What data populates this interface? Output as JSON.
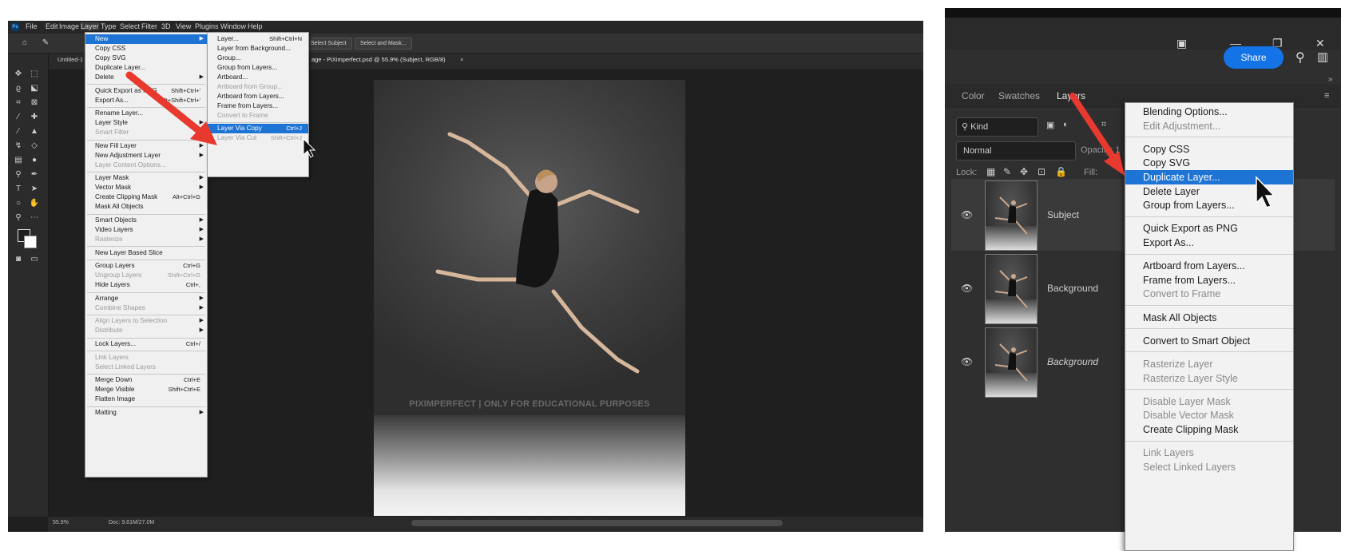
{
  "left": {
    "menubar": [
      "File",
      "Edit",
      "Image",
      "Layer",
      "Type",
      "Select",
      "Filter",
      "3D",
      "View",
      "Plugins",
      "Window",
      "Help"
    ],
    "options": {
      "select_subject": "Select Subject",
      "select_and_mask": "Select and Mask..."
    },
    "doc_tabs": {
      "first": "Untitled-1",
      "active": "age - PiXimperfect.psd @ 55.9% (Subject, RGB/8)"
    },
    "watermark": "PIXIMPERFECT | ONLY FOR EDUCATIONAL PURPOSES",
    "status": {
      "zoom": "55.9%",
      "doc": "Doc: 9.81M/27.0M"
    },
    "layer_menu": [
      {
        "label": "New",
        "hl": true,
        "sub": true
      },
      {
        "label": "Copy CSS"
      },
      {
        "label": "Copy SVG"
      },
      {
        "label": "Duplicate Layer..."
      },
      {
        "label": "Delete",
        "sub": true
      },
      {
        "sep": true
      },
      {
        "label": "Quick Export as PNG",
        "sc": "Shift+Ctrl+'"
      },
      {
        "label": "Export As...",
        "sc": "Alt+Shift+Ctrl+'"
      },
      {
        "sep": true
      },
      {
        "label": "Rename Layer..."
      },
      {
        "label": "Layer Style",
        "sub": true
      },
      {
        "label": "Smart Filter",
        "dis": true,
        "sub": true
      },
      {
        "sep": true
      },
      {
        "label": "New Fill Layer",
        "sub": true
      },
      {
        "label": "New Adjustment Layer",
        "sub": true
      },
      {
        "label": "Layer Content Options...",
        "dis": true
      },
      {
        "sep": true
      },
      {
        "label": "Layer Mask",
        "sub": true
      },
      {
        "label": "Vector Mask",
        "sub": true
      },
      {
        "label": "Create Clipping Mask",
        "sc": "Alt+Ctrl+G"
      },
      {
        "label": "Mask All Objects"
      },
      {
        "sep": true
      },
      {
        "label": "Smart Objects",
        "sub": true
      },
      {
        "label": "Video Layers",
        "sub": true
      },
      {
        "label": "Rasterize",
        "dis": true,
        "sub": true
      },
      {
        "sep": true
      },
      {
        "label": "New Layer Based Slice"
      },
      {
        "sep": true
      },
      {
        "label": "Group Layers",
        "sc": "Ctrl+G"
      },
      {
        "label": "Ungroup Layers",
        "sc": "Shift+Ctrl+G",
        "dis": true
      },
      {
        "label": "Hide Layers",
        "sc": "Ctrl+,"
      },
      {
        "sep": true
      },
      {
        "label": "Arrange",
        "sub": true
      },
      {
        "label": "Combine Shapes",
        "dis": true,
        "sub": true
      },
      {
        "sep": true
      },
      {
        "label": "Align Layers to Selection",
        "dis": true,
        "sub": true
      },
      {
        "label": "Distribute",
        "dis": true,
        "sub": true
      },
      {
        "sep": true
      },
      {
        "label": "Lock Layers...",
        "sc": "Ctrl+/"
      },
      {
        "sep": true
      },
      {
        "label": "Link Layers",
        "dis": true
      },
      {
        "label": "Select Linked Layers",
        "dis": true
      },
      {
        "sep": true
      },
      {
        "label": "Merge Down",
        "sc": "Ctrl+E"
      },
      {
        "label": "Merge Visible",
        "sc": "Shift+Ctrl+E"
      },
      {
        "label": "Flatten Image"
      },
      {
        "sep": true
      },
      {
        "label": "Matting",
        "sub": true
      }
    ],
    "new_submenu": [
      {
        "label": "Layer...",
        "sc": "Shift+Ctrl+N"
      },
      {
        "label": "Layer from Background..."
      },
      {
        "label": "Group..."
      },
      {
        "label": "Group from Layers..."
      },
      {
        "label": "Artboard..."
      },
      {
        "label": "Artboard from Group...",
        "dis": true
      },
      {
        "label": "Artboard from Layers..."
      },
      {
        "label": "Frame from Layers..."
      },
      {
        "label": "Convert to Frame",
        "dis": true
      },
      {
        "sep": true
      },
      {
        "label": "Layer Via Copy",
        "sc": "Ctrl+J",
        "hl": true
      },
      {
        "label": "Layer Via Cut",
        "sc": "Shift+Ctrl+J",
        "dis": true
      }
    ]
  },
  "right": {
    "share": "Share",
    "tabs": [
      "Color",
      "Swatches",
      "Layers"
    ],
    "kind": "Kind",
    "blend": "Normal",
    "opacity_label": "Opacity: 1",
    "lock_label": "Lock:",
    "fill_label": "Fill:",
    "layers": [
      {
        "name": "Subject",
        "selected": true,
        "italic": false
      },
      {
        "name": "Background",
        "selected": false,
        "italic": false
      },
      {
        "name": "Background",
        "selected": false,
        "italic": true,
        "locked": true
      }
    ],
    "context_menu": [
      {
        "label": "Blending Options..."
      },
      {
        "label": "Edit Adjustment...",
        "dis": true
      },
      {
        "sep": true
      },
      {
        "label": "Copy CSS"
      },
      {
        "label": "Copy SVG"
      },
      {
        "label": "Duplicate Layer...",
        "hl": true
      },
      {
        "label": "Delete Layer"
      },
      {
        "label": "Group from Layers..."
      },
      {
        "sep": true
      },
      {
        "label": "Quick Export as PNG"
      },
      {
        "label": "Export As..."
      },
      {
        "sep": true
      },
      {
        "label": "Artboard from Layers..."
      },
      {
        "label": "Frame from Layers..."
      },
      {
        "label": "Convert to Frame",
        "dis": true
      },
      {
        "sep": true
      },
      {
        "label": "Mask All Objects"
      },
      {
        "sep": true
      },
      {
        "label": "Convert to Smart Object"
      },
      {
        "sep": true
      },
      {
        "label": "Rasterize Layer",
        "dis": true
      },
      {
        "label": "Rasterize Layer Style",
        "dis": true
      },
      {
        "sep": true
      },
      {
        "label": "Disable Layer Mask",
        "dis": true
      },
      {
        "label": "Disable Vector Mask",
        "dis": true
      },
      {
        "label": "Create Clipping Mask"
      },
      {
        "sep": true
      },
      {
        "label": "Link Layers",
        "dis": true
      },
      {
        "label": "Select Linked Layers",
        "dis": true
      }
    ],
    "accent": "#1e74d4",
    "arrow_color": "#e8392f"
  }
}
